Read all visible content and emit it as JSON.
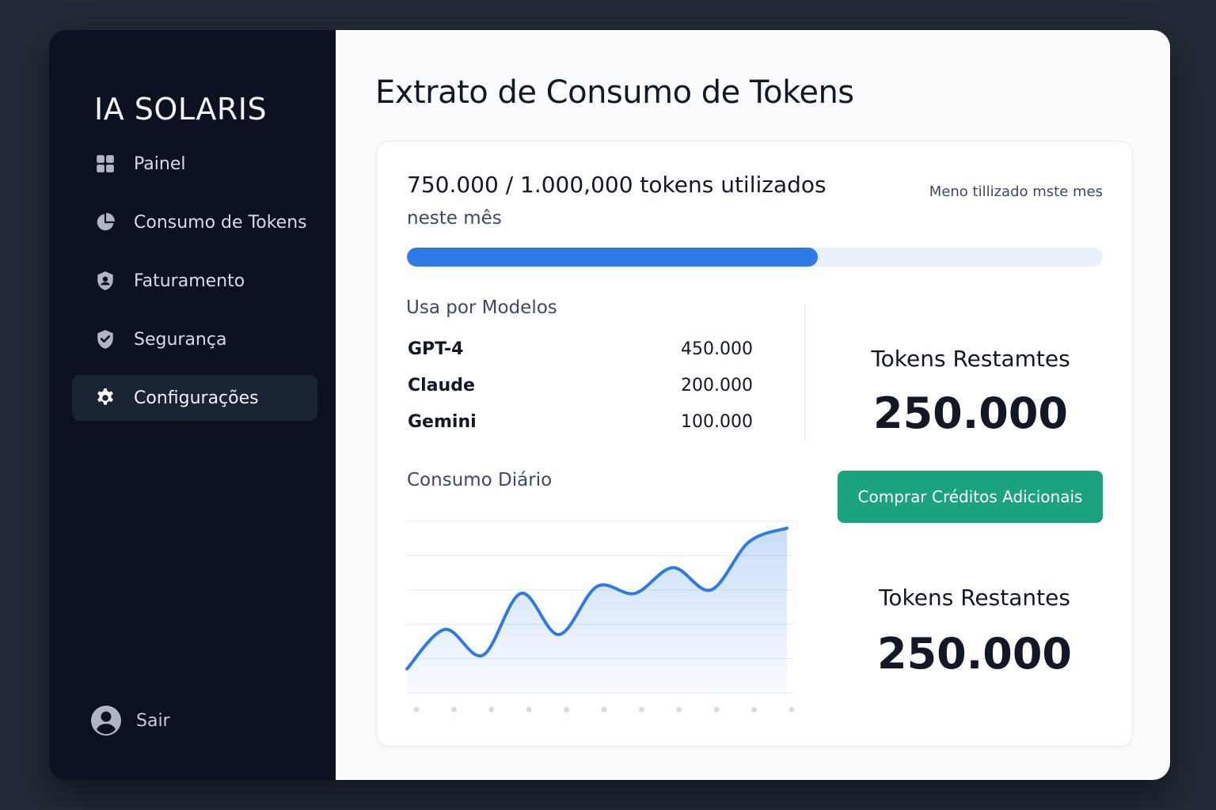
{
  "app": {
    "brand": "IA SOLARIS"
  },
  "sidebar": {
    "items": [
      {
        "label": "Painel",
        "icon": "grid-icon"
      },
      {
        "label": "Consumo de Tokens",
        "icon": "pie-chart-icon"
      },
      {
        "label": "Faturamento",
        "icon": "shield-user-icon"
      },
      {
        "label": "Segurança",
        "icon": "shield-check-icon"
      },
      {
        "label": "Configurações",
        "icon": "gear-icon",
        "active": true
      }
    ],
    "logout": {
      "label": "Sair",
      "icon": "user-avatar-icon"
    }
  },
  "main": {
    "title": "Extrato de Consumo de Tokens",
    "usage": {
      "headline": "750.000 / 1.000,000 tokens utilizados",
      "subline": "neste mês",
      "side_note": "Meno tillizado mste mes",
      "progress_percent": 59
    },
    "models": {
      "title": "Usa por Modelos",
      "rows": [
        {
          "name": "GPT-4",
          "value": "450.000"
        },
        {
          "name": "Claude",
          "value": "200.000"
        },
        {
          "name": "Gemini",
          "value": "100.000"
        }
      ]
    },
    "remaining_top": {
      "label": "Tokens Restamtes",
      "value": "250.000"
    },
    "remaining_bottom": {
      "label": "Tokens Restantes",
      "value": "250.000"
    },
    "buy_button": "Comprar Créditos Adicionais",
    "daily": {
      "title": "Consumo Diário"
    }
  },
  "colors": {
    "sidebar_bg": "#0b1120",
    "accent_blue": "#2e7be8",
    "button_green": "#1ba27e"
  },
  "chart_data": {
    "type": "area",
    "title": "Consumo Diário",
    "x": [
      1,
      2,
      3,
      4,
      5,
      6,
      7,
      8,
      9,
      10,
      11
    ],
    "values": [
      14,
      37,
      22,
      58,
      34,
      62,
      58,
      73,
      60,
      88,
      96
    ],
    "ylim": [
      0,
      100
    ],
    "grid": true,
    "xlabel": "",
    "ylabel": ""
  }
}
